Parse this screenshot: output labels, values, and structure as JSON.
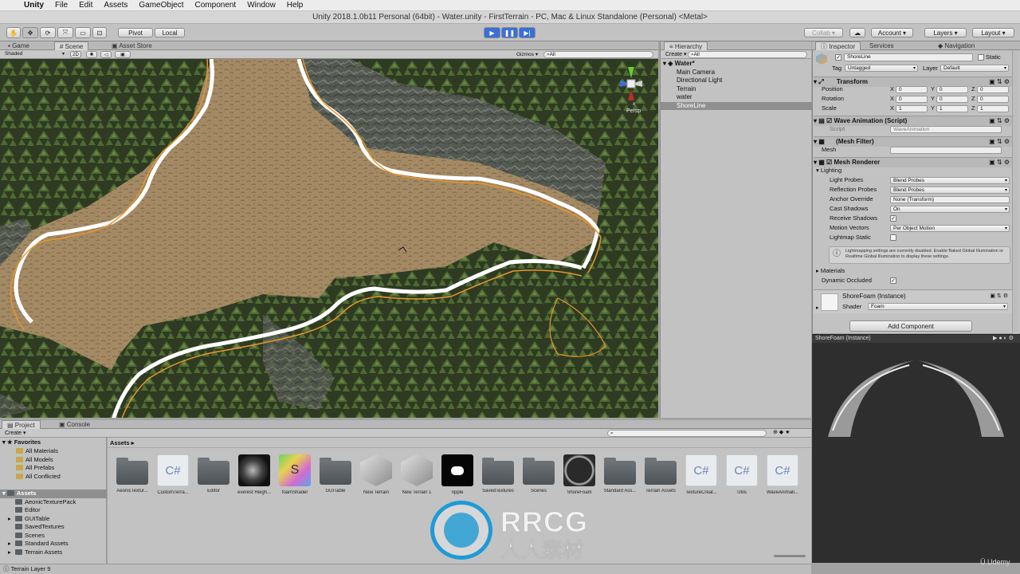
{
  "menubar": {
    "app": "Unity",
    "items": [
      "File",
      "Edit",
      "Assets",
      "GameObject",
      "Component",
      "Window",
      "Help"
    ]
  },
  "window_title": "Unity 2018.1.0b11 Personal (64bit) - Water.unity - FirstTerrain - PC, Mac & Linux Standalone (Personal) <Metal>",
  "toolbar": {
    "pivot": "Pivot",
    "local": "Local",
    "collab": "Collab ▾",
    "account": "Account",
    "layers": "Layers",
    "layout": "Layout"
  },
  "scene_tabs": {
    "game": "Game",
    "scene": "Scene",
    "asset_store": "Asset Store",
    "shading_mode": "Shaded",
    "mode_2d": "2D",
    "gizmos": "Gizmos",
    "search": "All",
    "persp": "Persp"
  },
  "hierarchy": {
    "tab": "Hierarchy",
    "create": "Create",
    "search": "All",
    "scene": "Water*",
    "items": [
      "Main Camera",
      "Directional Light",
      "Terrain",
      "water",
      "ShoreLine"
    ],
    "selected_index": 4
  },
  "inspector": {
    "tab": "Inspector",
    "services_tab": "Services",
    "navigation_tab": "Navigation",
    "object_name": "ShoreLine",
    "static_label": "Static",
    "tag_label": "Tag",
    "tag_value": "Untagged",
    "layer_label": "Layer",
    "layer_value": "Default",
    "transform": {
      "title": "Transform",
      "position_label": "Position",
      "rotation_label": "Rotation",
      "scale_label": "Scale",
      "position": [
        "0",
        "0",
        "0"
      ],
      "rotation": [
        "0",
        "0",
        "0"
      ],
      "scale": [
        "1",
        "1",
        "1"
      ],
      "x": "X",
      "y": "Y",
      "z": "Z"
    },
    "wave_animation": {
      "title": "Wave Animation (Script)",
      "script_label": "Script",
      "script_value": "WaveAnimation"
    },
    "mesh_filter": {
      "title": "(Mesh Filter)",
      "mesh_label": "Mesh",
      "mesh_value": ""
    },
    "mesh_renderer": {
      "title": "Mesh Renderer",
      "lighting": "Lighting",
      "light_probes_label": "Light Probes",
      "light_probes_value": "Blend Probes",
      "reflection_probes_label": "Reflection Probes",
      "reflection_probes_value": "Blend Probes",
      "anchor_override_label": "Anchor Override",
      "anchor_override_value": "None (Transform)",
      "cast_shadows_label": "Cast Shadows",
      "cast_shadows_value": "On",
      "receive_shadows_label": "Receive Shadows",
      "motion_vectors_label": "Motion Vectors",
      "motion_vectors_value": "Per Object Motion",
      "lightmap_static_label": "Lightmap Static",
      "info": "Lightmapping settings are currently disabled. Enable Baked Global Illumination or Realtime Global Illumination to display these settings.",
      "materials": "Materials",
      "dynamic_occluded": "Dynamic Occluded"
    },
    "material": {
      "name": "ShoreFoam (Instance)",
      "shader_label": "Shader",
      "shader_value": "Foam"
    },
    "add_component": "Add Component",
    "preview_title": "ShoreFoam (Instance)"
  },
  "project": {
    "tab": "Project",
    "console_tab": "Console",
    "create": "Create",
    "favorites": "Favorites",
    "favorite_items": [
      "All Materials",
      "All Models",
      "All Prefabs",
      "All Conflicted"
    ],
    "assets_root": "Assets",
    "tree": [
      {
        "label": "AeonicTexturePack",
        "arrow": ""
      },
      {
        "label": "Editor",
        "arrow": ""
      },
      {
        "label": "GUITable",
        "arrow": "▸"
      },
      {
        "label": "SavedTextures",
        "arrow": ""
      },
      {
        "label": "Scenes",
        "arrow": ""
      },
      {
        "label": "Standard Assets",
        "arrow": "▸"
      },
      {
        "label": "Terrain Assets",
        "arrow": "▸"
      }
    ],
    "breadcrumb": "Assets",
    "assets": [
      {
        "name": "AeonicTextur...",
        "kind": "folder"
      },
      {
        "name": "CustomTerra...",
        "kind": "cs"
      },
      {
        "name": "Editor",
        "kind": "folder"
      },
      {
        "name": "everest Heigh...",
        "kind": "heightmap"
      },
      {
        "name": "foamShader",
        "kind": "shader"
      },
      {
        "name": "GUITable",
        "kind": "folder"
      },
      {
        "name": "New Terrain",
        "kind": "terrain"
      },
      {
        "name": "New Terrain 1",
        "kind": "terrain"
      },
      {
        "name": "ripple",
        "kind": "ripple"
      },
      {
        "name": "SavedTextures",
        "kind": "folder"
      },
      {
        "name": "Scenes",
        "kind": "folder"
      },
      {
        "name": "ShoreFoam",
        "kind": "material"
      },
      {
        "name": "Standard Ass...",
        "kind": "folder"
      },
      {
        "name": "Terrain Assets",
        "kind": "folder"
      },
      {
        "name": "TextureCreat...",
        "kind": "cs"
      },
      {
        "name": "Utils",
        "kind": "cs"
      },
      {
        "name": "WaveAnimati...",
        "kind": "cs"
      }
    ],
    "cs_glyph": "C#",
    "shader_glyph": "S"
  },
  "statusbar": "Terrain Layer 9",
  "watermark": {
    "brand": "RRCG",
    "sub": "人人素材",
    "udemy": "Udemy"
  },
  "colors": {
    "play_blue": "#3b6fd9",
    "selection": "#8aa9d8",
    "foam_orange": "#e6962a"
  }
}
